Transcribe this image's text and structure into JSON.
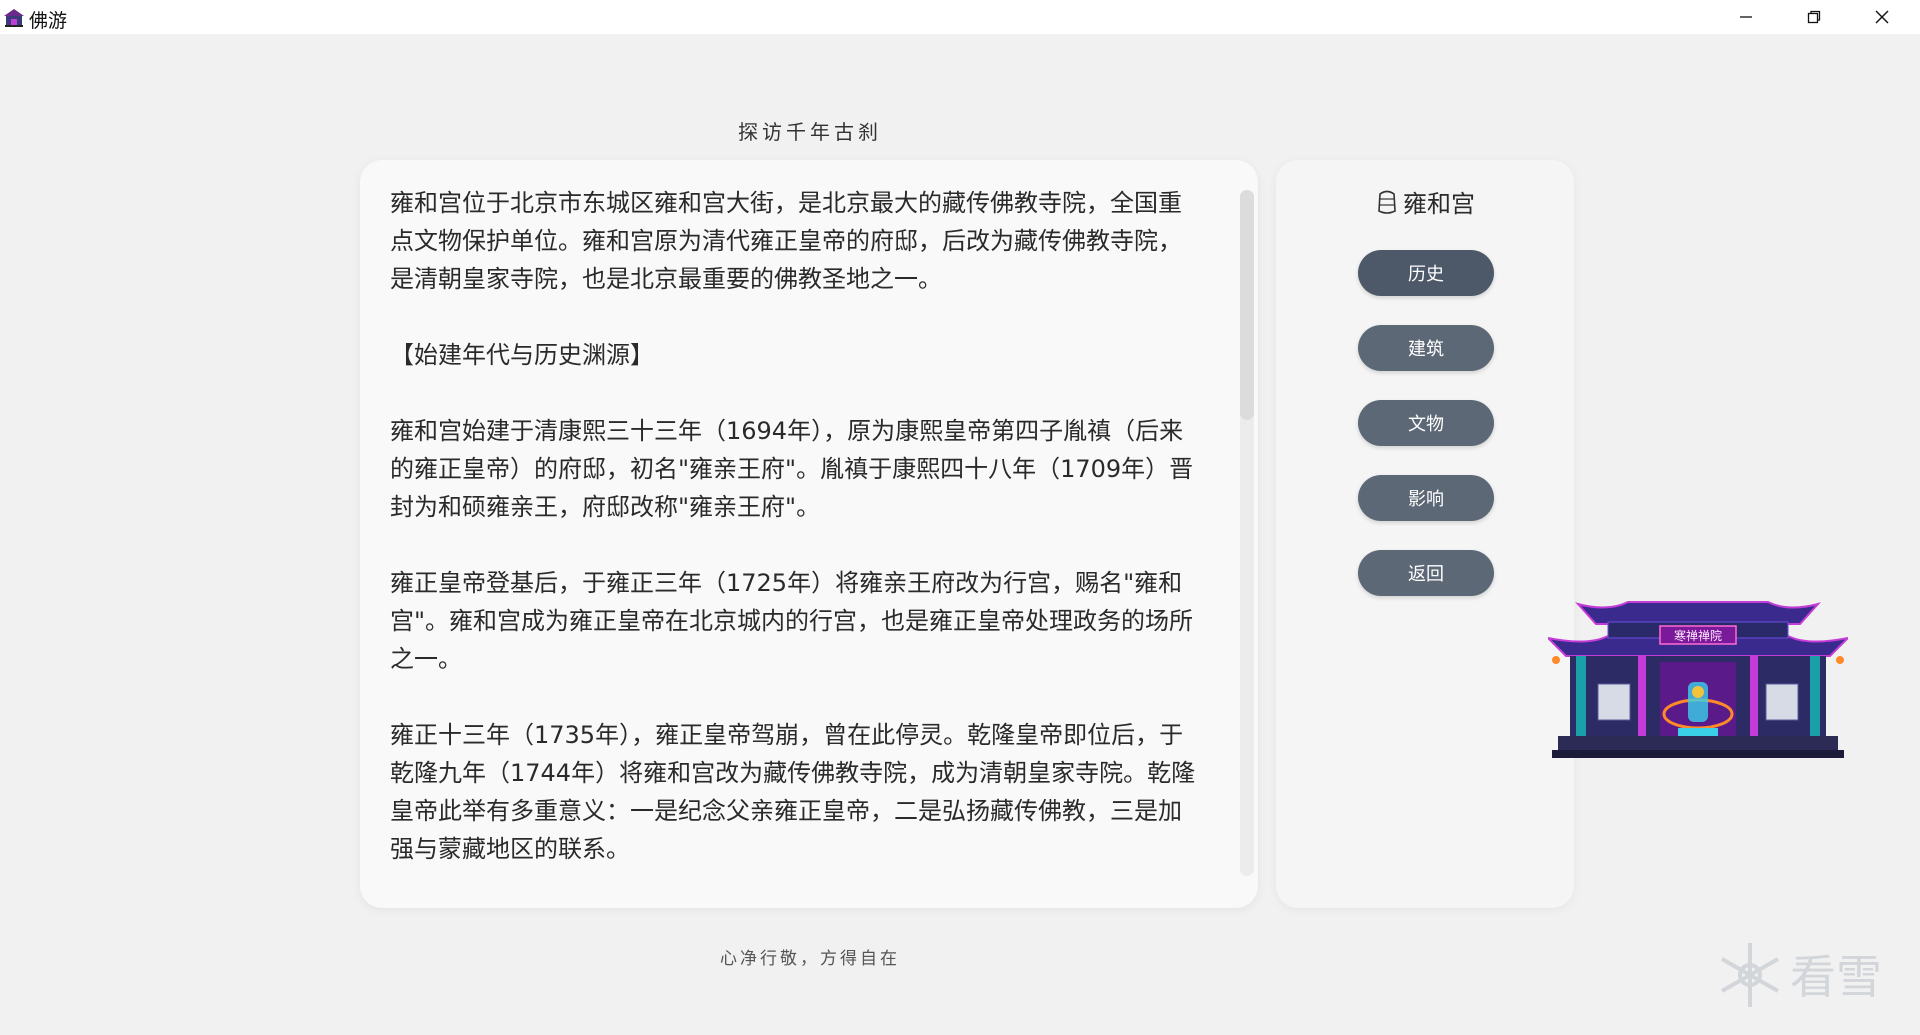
{
  "window": {
    "title": "佛游"
  },
  "header": {
    "heading": "探访千年古刹"
  },
  "content": {
    "paragraphs": [
      "雍和宫位于北京市东城区雍和宫大街，是北京最大的藏传佛教寺院，全国重点文物保护单位。雍和宫原为清代雍正皇帝的府邸，后改为藏传佛教寺院，是清朝皇家寺院，也是北京最重要的佛教圣地之一。",
      "【始建年代与历史渊源】",
      "雍和宫始建于清康熙三十三年（1694年），原为康熙皇帝第四子胤禛（后来的雍正皇帝）的府邸，初名\"雍亲王府\"。胤禛于康熙四十八年（1709年）晋封为和硕雍亲王，府邸改称\"雍亲王府\"。",
      "雍正皇帝登基后，于雍正三年（1725年）将雍亲王府改为行宫，赐名\"雍和宫\"。雍和宫成为雍正皇帝在北京城内的行宫，也是雍正皇帝处理政务的场所之一。",
      "雍正十三年（1735年），雍正皇帝驾崩，曾在此停灵。乾隆皇帝即位后，于乾隆九年（1744年）将雍和宫改为藏传佛教寺院，成为清朝皇家寺院。乾隆皇帝此举有多重意义：一是纪念父亲雍正皇帝，二是弘扬藏传佛教，三是加强与蒙藏地区的联系。"
    ]
  },
  "sidebar": {
    "title": "雍和宫",
    "buttons": [
      {
        "label": "历史"
      },
      {
        "label": "建筑"
      },
      {
        "label": "文物"
      },
      {
        "label": "影响"
      },
      {
        "label": "返回"
      }
    ]
  },
  "temple_sign": "寒禅禅院",
  "footer": {
    "caption": "心净行敬，方得自在"
  },
  "watermark": {
    "text": "看雪"
  },
  "icons": {
    "app": "temple-icon",
    "sidebar_title": "bell-icon",
    "minimize": "minimize-icon",
    "maximize": "restore-icon",
    "close": "close-icon"
  },
  "colors": {
    "button_bg": "#5d6876",
    "page_bg": "#f1f1f1",
    "card_bg": "#f9f9f9",
    "temple_neon": "#c43cd8"
  }
}
